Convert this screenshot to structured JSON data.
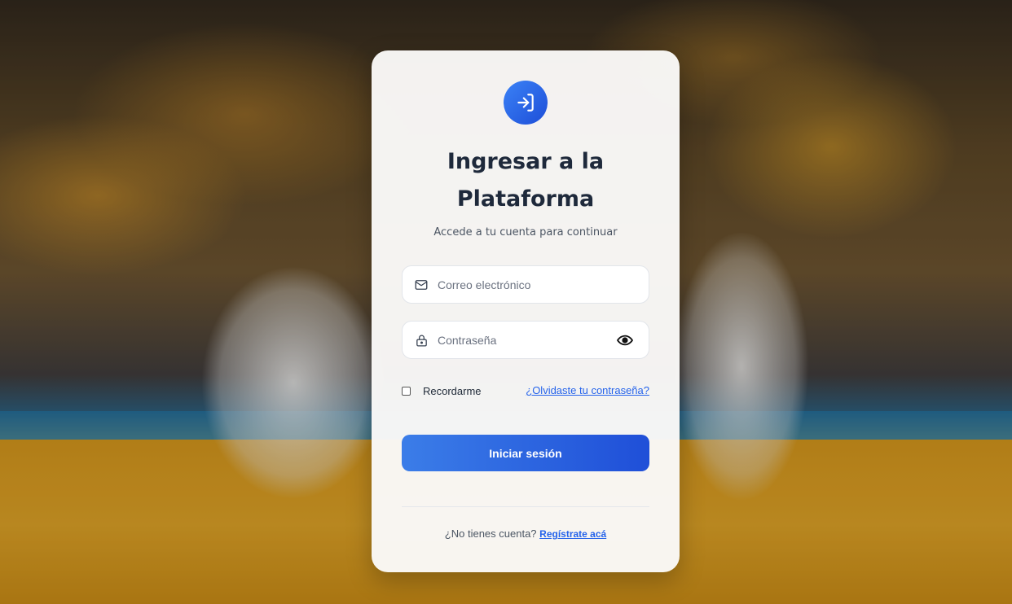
{
  "login": {
    "title_line1": "Ingresar a la",
    "title_line2": "Plataforma",
    "subtitle": "Accede a tu cuenta para continuar",
    "email_placeholder": "Correo electrónico",
    "email_value": "",
    "password_placeholder": "Contraseña",
    "password_value": "",
    "remember_label": "Recordarme",
    "remember_checked": false,
    "forgot_link": "¿Olvidaste tu contraseña?",
    "submit_label": "Iniciar sesión",
    "no_account_text": "¿No tienes cuenta?",
    "register_link": "Regístrate acá"
  },
  "icons": {
    "logo": "login-arrow-icon",
    "email": "envelope-icon",
    "password": "lock-icon",
    "toggle": "eye-icon"
  },
  "colors": {
    "accent": "#2563eb",
    "button_start": "#3b7de8",
    "button_end": "#1f4fd8",
    "title": "#1e293b"
  }
}
